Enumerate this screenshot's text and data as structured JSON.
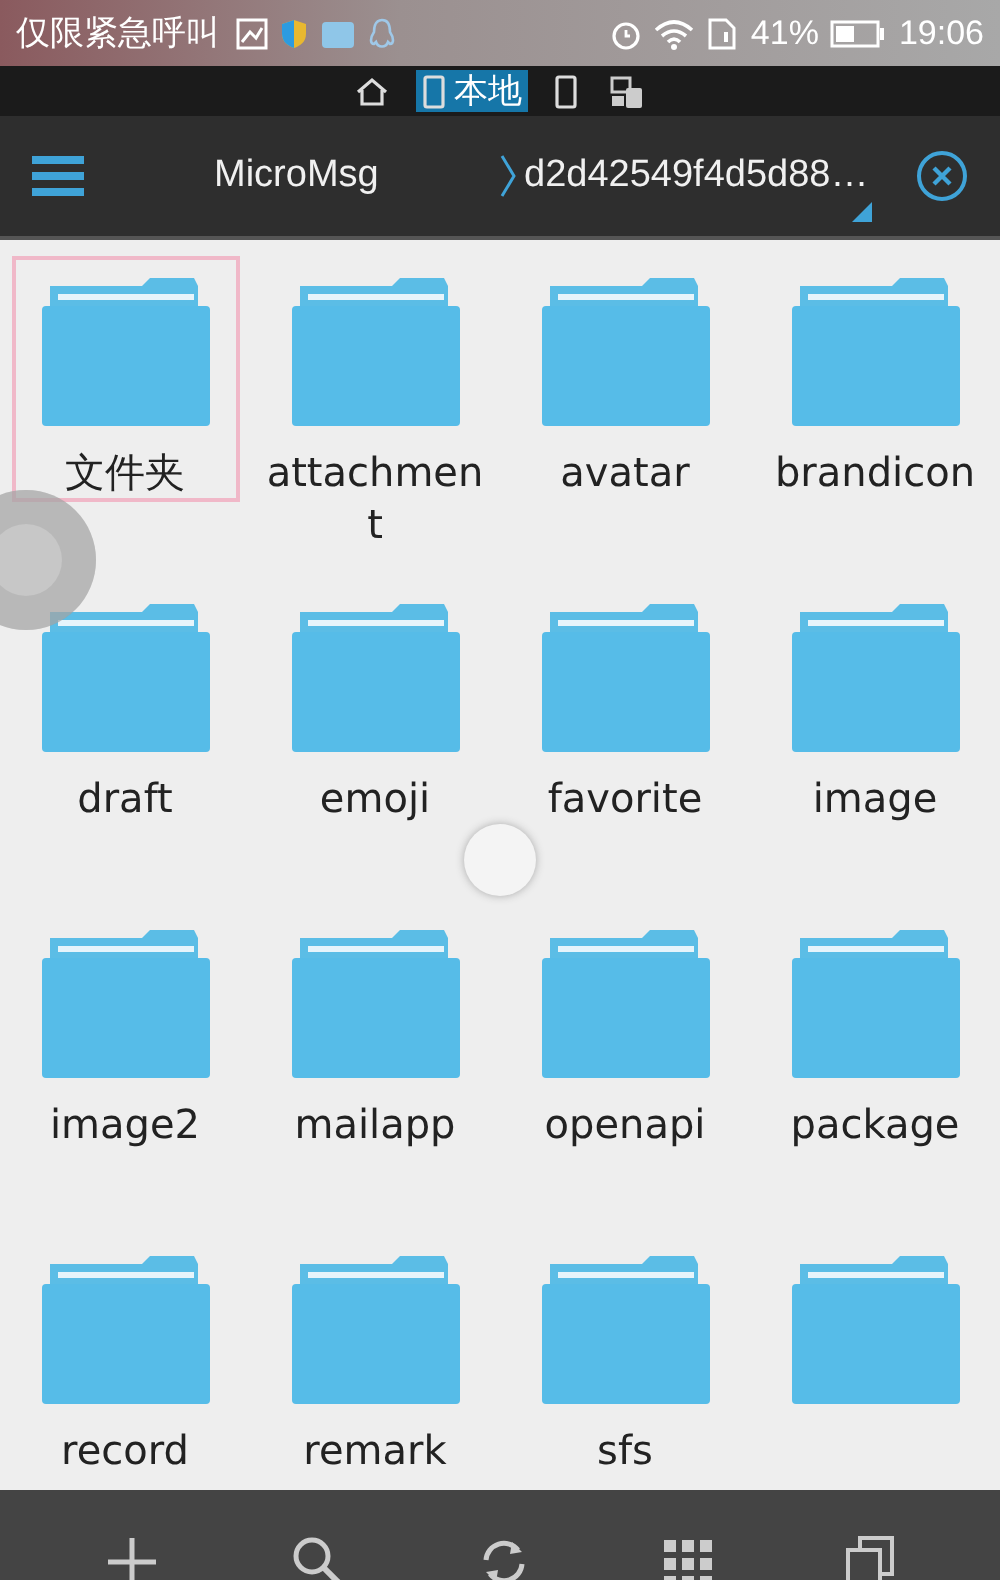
{
  "status_bar": {
    "notification": "仅限紧急呼叫",
    "battery": "41%",
    "time": "19:06"
  },
  "location_tabs": [
    {
      "kind": "home",
      "selected": false
    },
    {
      "kind": "local",
      "label": "本地",
      "selected": true
    },
    {
      "kind": "phone",
      "selected": false
    },
    {
      "kind": "devices",
      "selected": false
    }
  ],
  "path_bar": {
    "crumbs": [
      "MicroMsg",
      "d2d42549f4d5d88…"
    ]
  },
  "folders": [
    {
      "name": "文件夹",
      "selected": true
    },
    {
      "name": "attachment",
      "selected": false
    },
    {
      "name": "avatar",
      "selected": false
    },
    {
      "name": "brandicon",
      "selected": false
    },
    {
      "name": "draft",
      "selected": false
    },
    {
      "name": "emoji",
      "selected": false
    },
    {
      "name": "favorite",
      "selected": false
    },
    {
      "name": "image",
      "selected": false
    },
    {
      "name": "image2",
      "selected": false
    },
    {
      "name": "mailapp",
      "selected": false
    },
    {
      "name": "openapi",
      "selected": false
    },
    {
      "name": "package",
      "selected": false
    },
    {
      "name": "record",
      "selected": false
    },
    {
      "name": "remark",
      "selected": false
    },
    {
      "name": "sfs",
      "selected": false
    },
    {
      "selected": false
    }
  ],
  "bottom_bar": [
    {
      "kind": "add"
    },
    {
      "kind": "search"
    },
    {
      "kind": "refresh"
    },
    {
      "kind": "grid"
    },
    {
      "kind": "windows"
    }
  ]
}
